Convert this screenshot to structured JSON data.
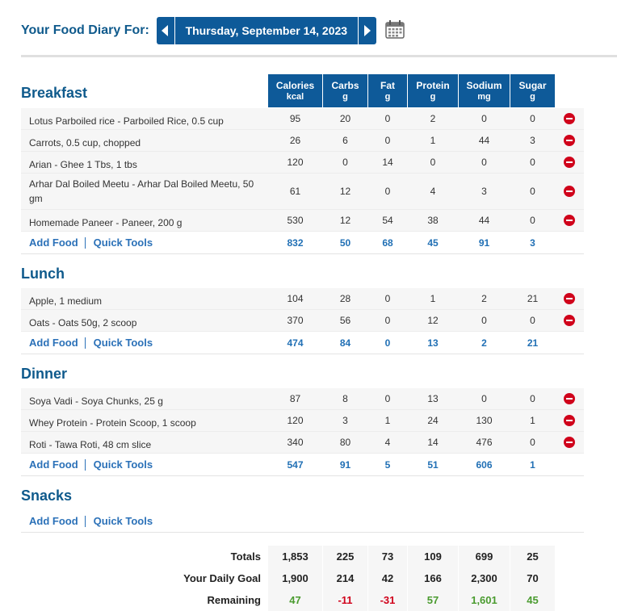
{
  "header": {
    "label": "Your Food Diary For:",
    "date": "Thursday, September 14, 2023"
  },
  "columns": [
    {
      "name": "Calories",
      "unit": "kcal"
    },
    {
      "name": "Carbs",
      "unit": "g"
    },
    {
      "name": "Fat",
      "unit": "g"
    },
    {
      "name": "Protein",
      "unit": "g"
    },
    {
      "name": "Sodium",
      "unit": "mg"
    },
    {
      "name": "Sugar",
      "unit": "g"
    }
  ],
  "links": {
    "add_food": "Add Food",
    "quick_tools": "Quick Tools"
  },
  "meals": {
    "breakfast": {
      "title": "Breakfast",
      "items": [
        {
          "name": "Lotus Parboiled rice - Parboiled Rice, 0.5 cup",
          "v": [
            "95",
            "20",
            "0",
            "2",
            "0",
            "0"
          ]
        },
        {
          "name": "Carrots, 0.5 cup, chopped",
          "v": [
            "26",
            "6",
            "0",
            "1",
            "44",
            "3"
          ]
        },
        {
          "name": "Arian - Ghee 1 Tbs, 1 tbs",
          "v": [
            "120",
            "0",
            "14",
            "0",
            "0",
            "0"
          ]
        },
        {
          "name": "Arhar Dal Boiled Meetu - Arhar Dal Boiled Meetu, 50 gm",
          "v": [
            "61",
            "12",
            "0",
            "4",
            "3",
            "0"
          ]
        },
        {
          "name": "Homemade Paneer - Paneer, 200 g",
          "v": [
            "530",
            "12",
            "54",
            "38",
            "44",
            "0"
          ]
        }
      ],
      "sum": [
        "832",
        "50",
        "68",
        "45",
        "91",
        "3"
      ]
    },
    "lunch": {
      "title": "Lunch",
      "items": [
        {
          "name": "Apple, 1 medium",
          "v": [
            "104",
            "28",
            "0",
            "1",
            "2",
            "21"
          ]
        },
        {
          "name": "Oats - Oats 50g, 2 scoop",
          "v": [
            "370",
            "56",
            "0",
            "12",
            "0",
            "0"
          ]
        }
      ],
      "sum": [
        "474",
        "84",
        "0",
        "13",
        "2",
        "21"
      ]
    },
    "dinner": {
      "title": "Dinner",
      "items": [
        {
          "name": "Soya Vadi - Soya Chunks, 25 g",
          "v": [
            "87",
            "8",
            "0",
            "13",
            "0",
            "0"
          ]
        },
        {
          "name": "Whey Protein - Protein Scoop, 1 scoop",
          "v": [
            "120",
            "3",
            "1",
            "24",
            "130",
            "1"
          ]
        },
        {
          "name": "Roti - Tawa Roti, 48 cm slice",
          "v": [
            "340",
            "80",
            "4",
            "14",
            "476",
            "0"
          ]
        }
      ],
      "sum": [
        "547",
        "91",
        "5",
        "51",
        "606",
        "1"
      ]
    },
    "snacks": {
      "title": "Snacks",
      "items": []
    }
  },
  "totals": {
    "totals_label": "Totals",
    "totals": [
      "1,853",
      "225",
      "73",
      "109",
      "699",
      "25"
    ],
    "goal_label": "Your Daily Goal",
    "goal": [
      "1,900",
      "214",
      "42",
      "166",
      "2,300",
      "70"
    ],
    "remaining_label": "Remaining",
    "remaining": [
      "47",
      "-11",
      "-31",
      "57",
      "1,601",
      "45"
    ]
  },
  "colors": {
    "header_blue": "#0e5a99",
    "title_blue": "#0f5a8c",
    "link_blue": "#2b71b8",
    "delete_red": "#d0021b",
    "positive": "#4a9b2f",
    "negative": "#d0021b"
  }
}
